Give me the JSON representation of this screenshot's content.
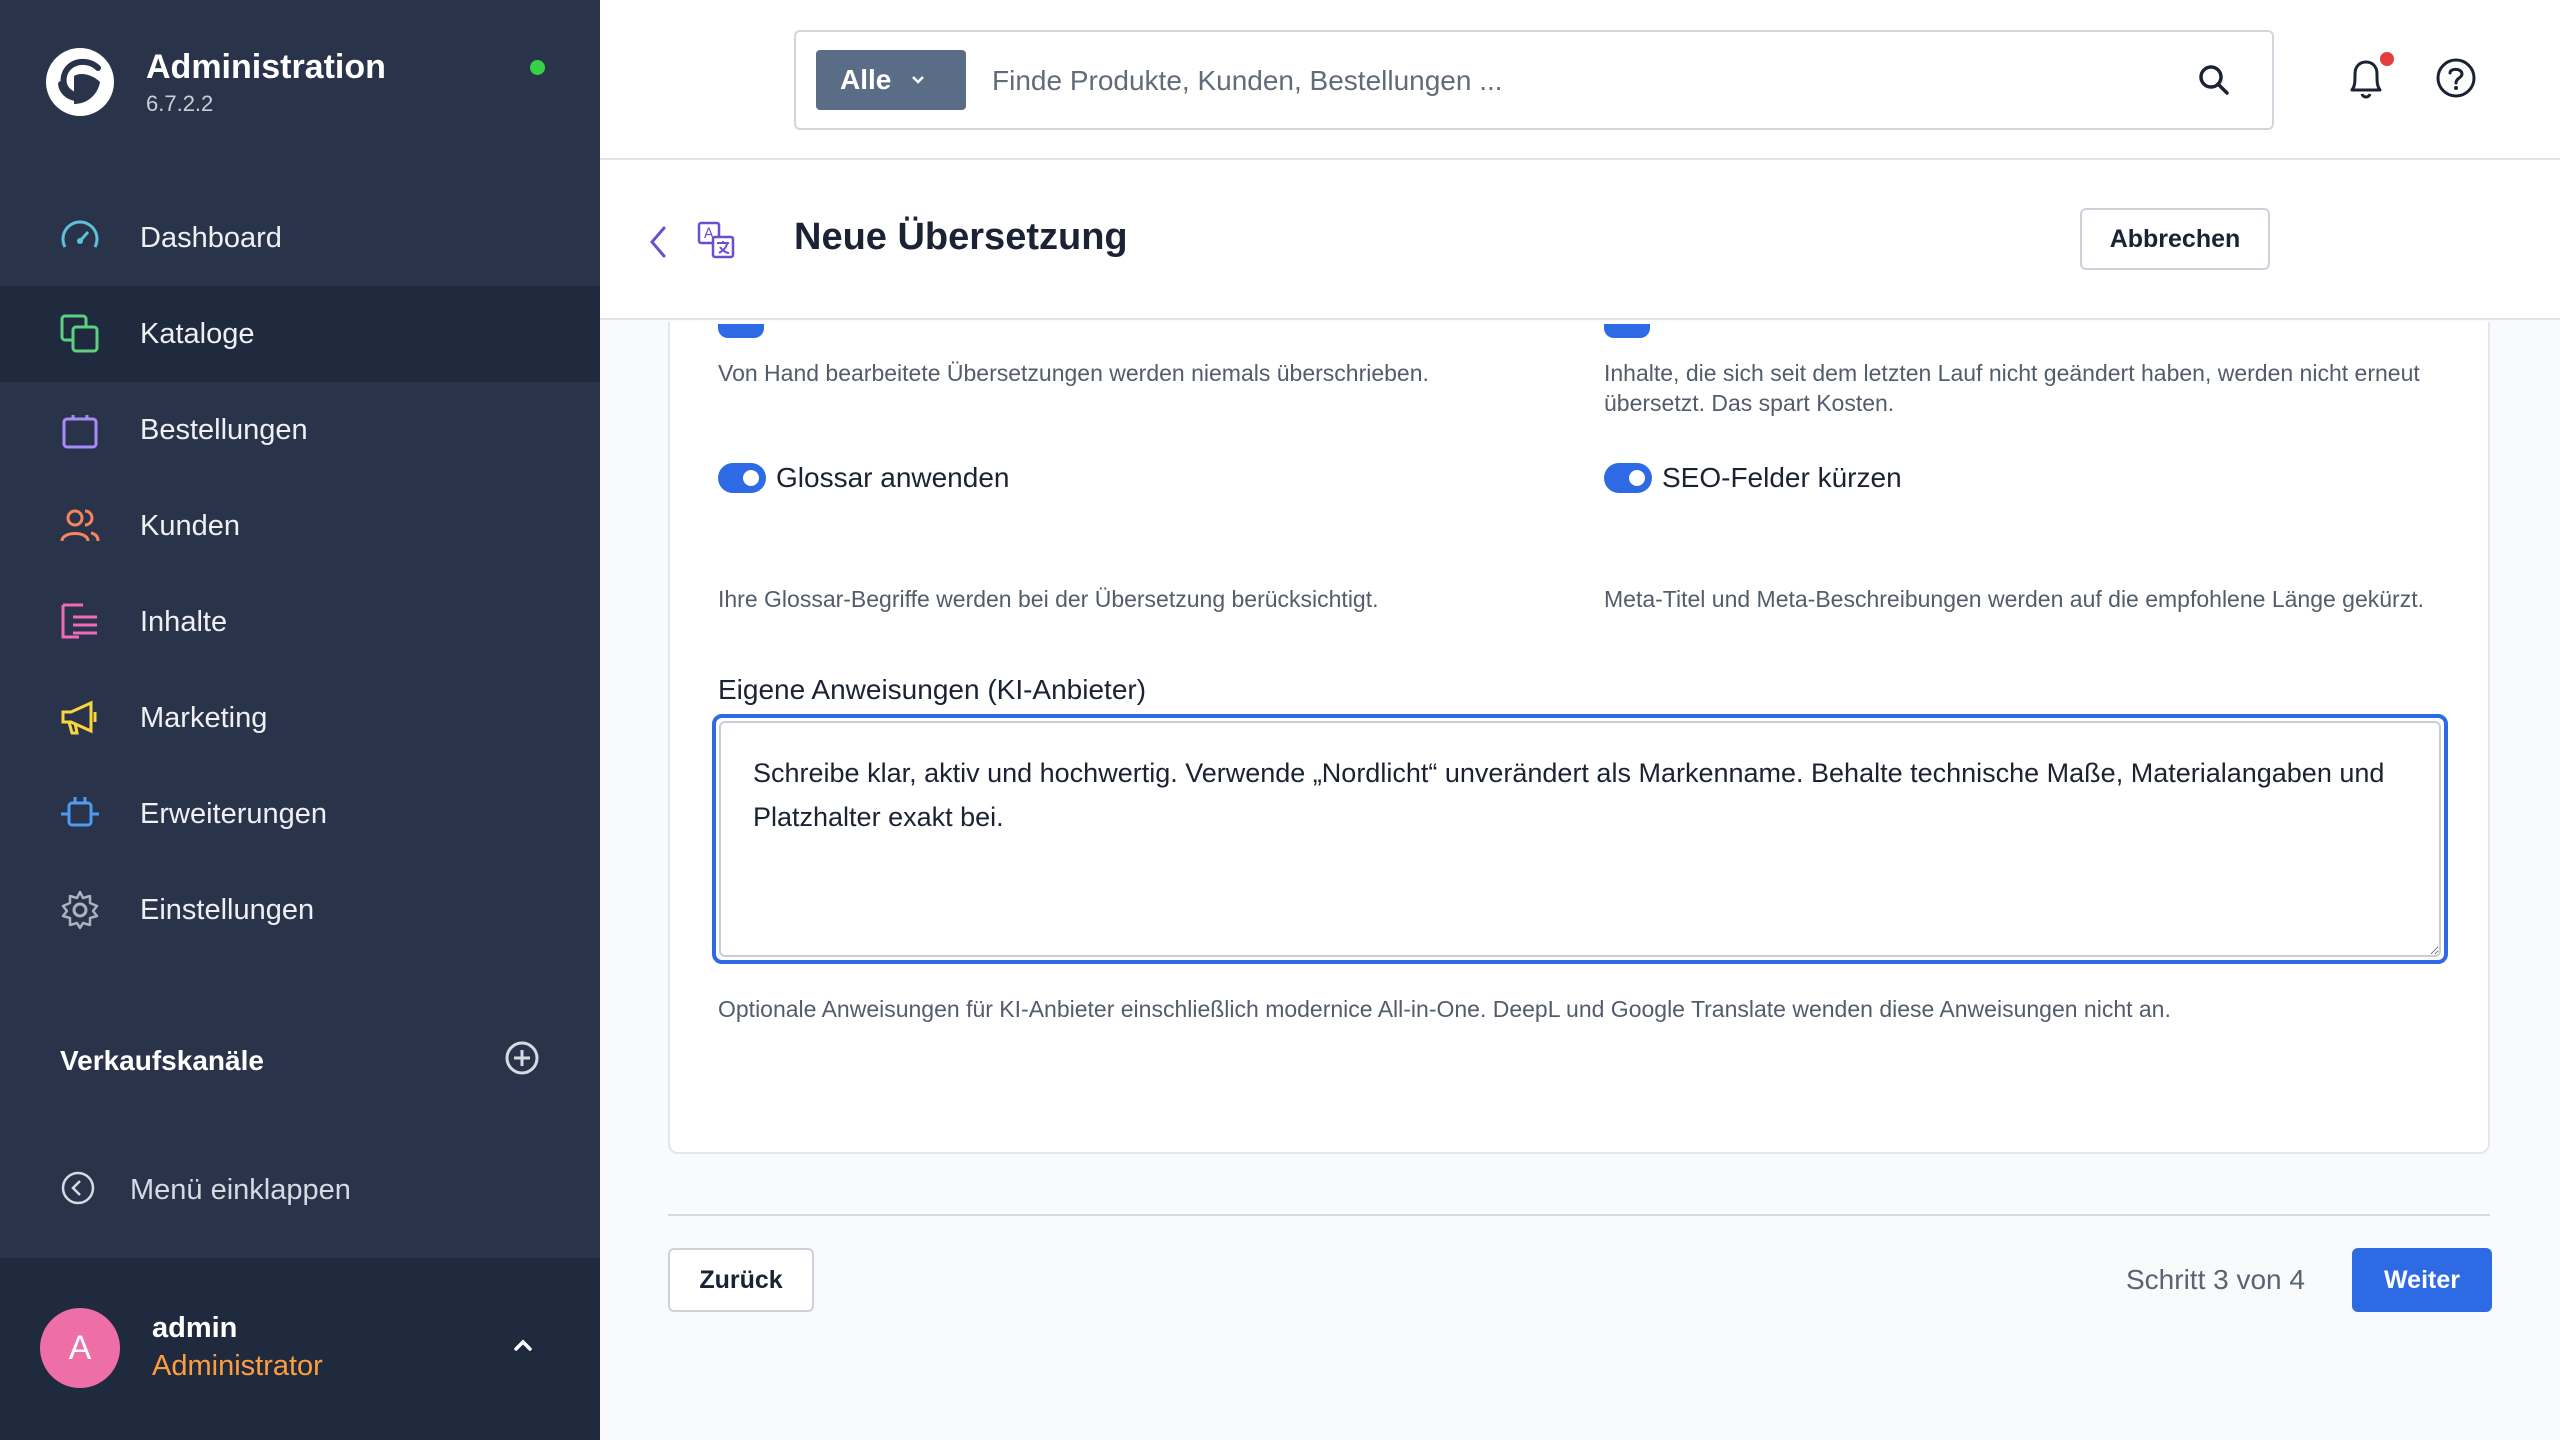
{
  "brand": {
    "title": "Administration",
    "version": "6.7.2.2"
  },
  "nav": {
    "items": [
      {
        "label": "Dashboard"
      },
      {
        "label": "Kataloge"
      },
      {
        "label": "Bestellungen"
      },
      {
        "label": "Kunden"
      },
      {
        "label": "Inhalte"
      },
      {
        "label": "Marketing"
      },
      {
        "label": "Erweiterungen"
      },
      {
        "label": "Einstellungen"
      }
    ],
    "active": "Kataloge"
  },
  "sales_channels": {
    "title": "Verkaufskanäle"
  },
  "collapse": {
    "label": "Menü einklappen"
  },
  "user": {
    "initial": "A",
    "name": "admin",
    "role": "Administrator"
  },
  "search": {
    "filter_label": "Alle",
    "placeholder": "Finde Produkte, Kunden, Bestellungen ..."
  },
  "header": {
    "title": "Neue Übersetzung",
    "cancel_label": "Abbrechen"
  },
  "options": {
    "top_left_desc": "Von Hand bearbeitete Übersetzungen werden niemals überschrieben.",
    "top_right_desc": "Inhalte, die sich seit dem letzten Lauf nicht geändert haben, werden nicht erneut übersetzt. Das spart Kosten.",
    "glossary_label": "Glossar anwenden",
    "glossary_desc": "Ihre Glossar-Begriffe werden bei der Übersetzung berücksichtigt.",
    "seo_label": "SEO-Felder kürzen",
    "seo_desc": "Meta-Titel und Meta-Beschreibungen werden auf die empfohlene Länge gekürzt."
  },
  "instructions": {
    "label": "Eigene Anweisungen (KI-Anbieter)",
    "value": "Schreibe klar, aktiv und hochwertig. Verwende „Nordlicht“ unverändert als Markenname. Behalte technische Maße, Materialangaben und Platzhalter exakt bei.",
    "help": "Optionale Anweisungen für KI-Anbieter einschließlich modernice All-in-One. DeepL und Google Translate wenden diese Anweisungen nicht an."
  },
  "footer": {
    "back_label": "Zurück",
    "step_text": "Schritt 3 von 4",
    "next_label": "Weiter"
  },
  "colors": {
    "sidebar": "#29344b",
    "active": "#1f2a3f",
    "primary": "#2d6ae3",
    "role": "#ff9e3d",
    "avatar": "#ee6fa8",
    "online": "#37d046"
  }
}
